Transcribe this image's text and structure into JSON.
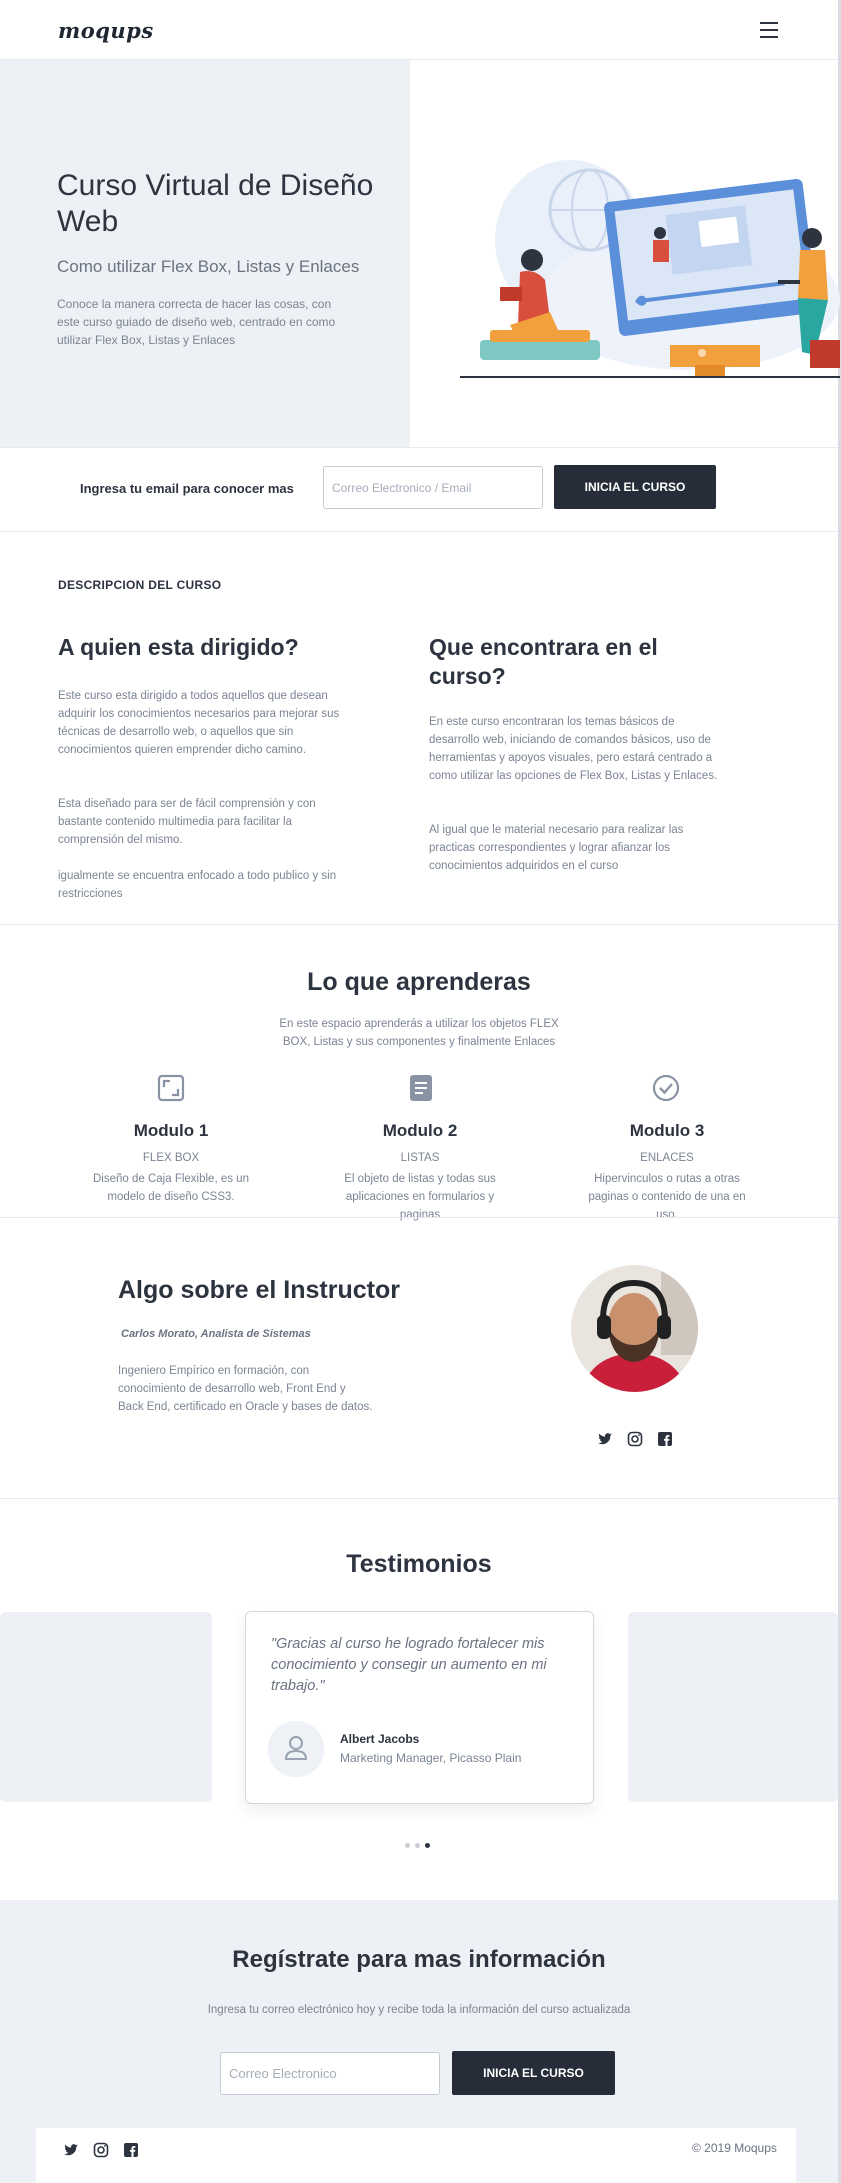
{
  "header": {
    "logo": "moqups",
    "menu_icon": "hamburger-icon"
  },
  "hero": {
    "title": "Curso Virtual de Diseño Web",
    "subtitle": "Como utilizar Flex Box, Listas y Enlaces",
    "description": "Conoce la manera correcta de hacer las cosas, con este curso guiado de diseño web, centrado en como utilizar Flex Box, Listas y Enlaces"
  },
  "email_signup": {
    "label": "Ingresa tu email para conocer mas",
    "placeholder": "Correo Electronico / Email",
    "button": "INICIA EL CURSO"
  },
  "description": {
    "heading": "DESCRIPCION DEL CURSO",
    "left": {
      "title": "A quien esta dirigido?",
      "p1": "Este curso esta dirigido a todos aquellos que desean adquirir los conocimientos necesarios para mejorar sus técnicas de desarrollo web, o aquellos que sin conocimientos quieren emprender dicho camino.",
      "p2": "Esta diseñado para ser de fácil comprensión y con bastante contenido multimedia para facilitar la comprensión del mismo.",
      "p3": "igualmente se encuentra enfocado a todo publico y sin restricciones"
    },
    "right": {
      "title": "Que encontrara en el curso?",
      "p1": "En este curso encontraran los temas básicos de desarrollo web, iniciando de comandos básicos, uso de herramientas y apoyos visuales, pero estará centrado a como utilizar las opciones de Flex Box, Listas y Enlaces.",
      "p2": "Al igual que le material necesario para realizar las practicas correspondientes y lograr afianzar los conocimientos adquiridos en el curso"
    }
  },
  "learn": {
    "title": "Lo que aprenderas",
    "subtitle": "En este espacio aprenderás a utilizar los objetos FLEX BOX, Listas y sus componentes y finalmente Enlaces",
    "modules": [
      {
        "icon": "expand-icon",
        "title": "Modulo 1",
        "tag": "FLEX BOX",
        "text": "Diseño de Caja Flexible,  es un modelo de diseño CSS3."
      },
      {
        "icon": "document-icon",
        "title": "Modulo 2",
        "tag": "LISTAS",
        "text": "El objeto de listas y todas sus aplicaciones en formularios y paginas"
      },
      {
        "icon": "check-circle-icon",
        "title": "Modulo 3",
        "tag": "ENLACES",
        "text": "Hipervinculos o rutas a otras paginas o contenido de una en uso."
      }
    ]
  },
  "instructor": {
    "title": "Algo sobre el Instructor",
    "name": "Carlos Morato, Analista de Sistemas",
    "bio": "Ingeniero Empírico en formación, con conocimiento de desarrollo web, Front End y Back End, certificado en Oracle y bases de datos.",
    "social": [
      "twitter-icon",
      "instagram-icon",
      "facebook-icon"
    ]
  },
  "testimonials": {
    "title": "Testimonios",
    "quote": "\"Gracias al curso he logrado fortalecer mis conocimiento y consegir un aumento en mi trabajo.\"",
    "name": "Albert Jacobs",
    "role": "Marketing Manager, Picasso Plain",
    "active_dot": 3,
    "dot_count": 3
  },
  "register": {
    "title": "Regístrate para mas información",
    "subtitle": "Ingresa tu correo electrónico hoy y recibe toda la información del curso actualizada",
    "placeholder": "Correo Electronico",
    "button": "INICIA EL CURSO"
  },
  "footer": {
    "social": [
      "twitter-icon",
      "instagram-icon",
      "facebook-icon"
    ],
    "copyright": "© 2019  Moqups"
  },
  "colors": {
    "dark": "#262c38",
    "light_bg": "#edf0f4",
    "muted_text": "#7b8493",
    "accent_orange": "#f2a03d",
    "accent_blue": "#5b8fd9"
  }
}
